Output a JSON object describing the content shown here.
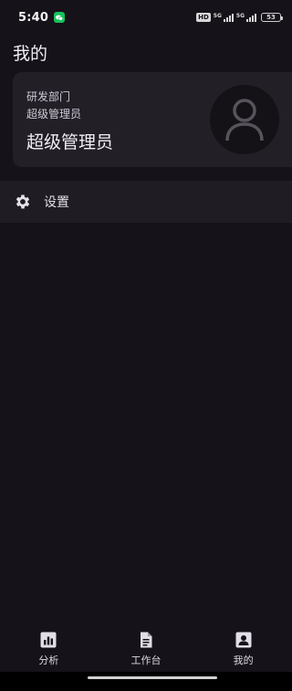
{
  "status_bar": {
    "time": "5:40",
    "hd": "HD",
    "network_1": "5G",
    "network_2": "5G",
    "battery": "53"
  },
  "page": {
    "title": "我的"
  },
  "profile": {
    "department": "研发部门",
    "role_small": "超级管理员",
    "role_big": "超级管理员",
    "avatar_icon": "user-avatar-icon"
  },
  "menu": {
    "settings": {
      "label": "设置",
      "icon": "gear-icon"
    }
  },
  "tabs": [
    {
      "label": "分析",
      "icon": "chart-icon"
    },
    {
      "label": "工作台",
      "icon": "document-icon"
    },
    {
      "label": "我的",
      "icon": "contact-icon"
    }
  ],
  "colors": {
    "background": "#151219",
    "card": "#221f27",
    "wechat_green": "#16c15b"
  }
}
